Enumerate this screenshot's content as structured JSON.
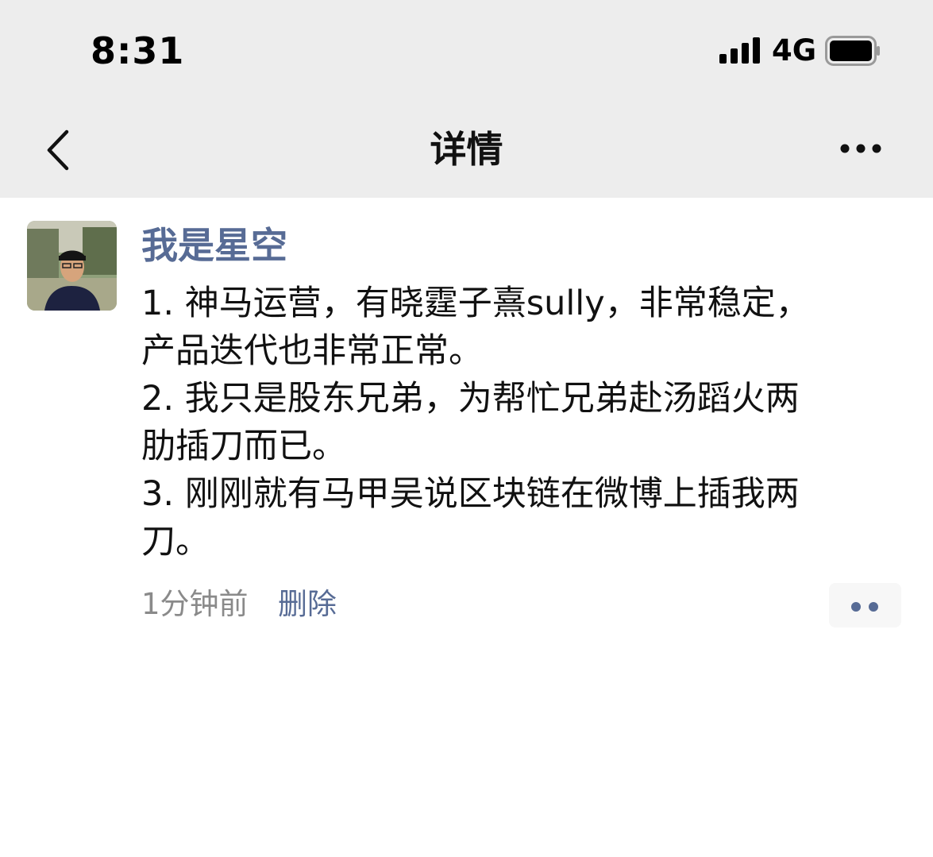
{
  "status_bar": {
    "time": "8:31",
    "network": "4G",
    "signal_icon": "cellular-signal-icon",
    "battery_icon": "battery-icon"
  },
  "nav": {
    "title": "详情",
    "back_icon": "chevron-left-icon",
    "more_icon": "more-dots-icon"
  },
  "post": {
    "author": "我是星空",
    "avatar_icon": "user-avatar-photo",
    "lines": [
      "1. 神马运营，有晓霆子熹sully，非常稳定，",
      "产品迭代也非常正常。",
      "2. 我只是股东兄弟，为帮忙兄弟赴汤蹈火两",
      "肋插刀而已。",
      "3. 刚刚就有马甲吴说区块链在微博上插我两",
      "刀。"
    ],
    "time": "1分钟前",
    "delete_label": "删除",
    "comment_icon": "comment-dots-icon"
  },
  "colors": {
    "header_bg": "#ededed",
    "link": "#576b95",
    "meta_text": "#8a8a8a"
  }
}
